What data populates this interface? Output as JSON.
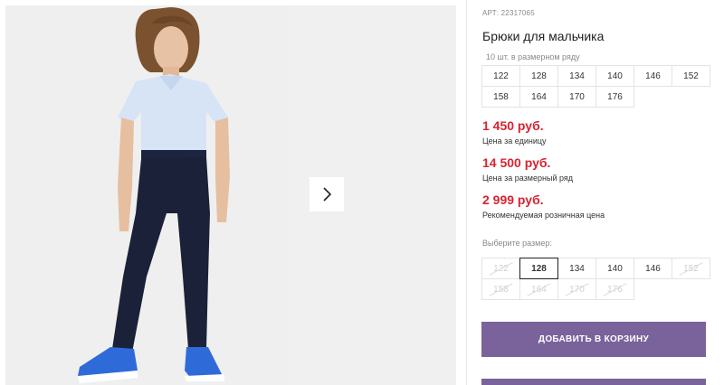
{
  "product": {
    "article": "АРТ: 22317065",
    "title": "Брюки для мальчика",
    "pack_note": "10 шт. в размерном ряду",
    "pack_sizes": [
      "122",
      "128",
      "134",
      "140",
      "146",
      "152",
      "158",
      "164",
      "170",
      "176"
    ]
  },
  "prices": [
    {
      "value": "1 450 руб.",
      "label": "Цена за единицу"
    },
    {
      "value": "14 500 руб.",
      "label": "Цена за размерный ряд"
    },
    {
      "value": "2 999 руб.",
      "label": "Рекомендуемая розничная цена"
    }
  ],
  "size_selector": {
    "label": "Выберите размер:",
    "selected": "128",
    "options": [
      {
        "size": "122",
        "available": false
      },
      {
        "size": "128",
        "available": true
      },
      {
        "size": "134",
        "available": true
      },
      {
        "size": "140",
        "available": true
      },
      {
        "size": "146",
        "available": true
      },
      {
        "size": "152",
        "available": false
      },
      {
        "size": "158",
        "available": false
      },
      {
        "size": "164",
        "available": false
      },
      {
        "size": "170",
        "available": false
      },
      {
        "size": "176",
        "available": false
      }
    ]
  },
  "actions": {
    "add_to_cart": "ДОБАВИТЬ В КОРЗИНУ"
  },
  "gallery": {
    "next_icon": "chevron-right-icon"
  },
  "colors": {
    "accent": "#7a629b",
    "price": "#d9242f"
  }
}
